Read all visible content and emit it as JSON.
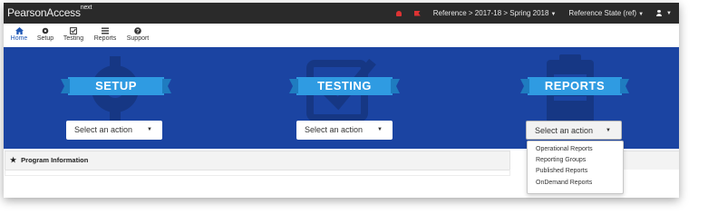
{
  "header": {
    "brand": "PearsonAccess",
    "brand_sup": "next",
    "breadcrumb": "Reference > 2017-18 > Spring 2018",
    "organization": "Reference State (ref)"
  },
  "nav": {
    "items": [
      {
        "label": "Home",
        "icon": "home-icon"
      },
      {
        "label": "Setup",
        "icon": "gear-icon"
      },
      {
        "label": "Testing",
        "icon": "checkbox-icon"
      },
      {
        "label": "Reports",
        "icon": "list-icon"
      },
      {
        "label": "Support",
        "icon": "question-icon"
      }
    ]
  },
  "sections": [
    {
      "title": "SETUP",
      "action_label": "Select an action"
    },
    {
      "title": "TESTING",
      "action_label": "Select an action"
    },
    {
      "title": "REPORTS",
      "action_label": "Select an action"
    }
  ],
  "reports_menu": {
    "items": [
      "Operational Reports",
      "Reporting Groups",
      "Published Reports",
      "OnDemand Reports"
    ]
  },
  "program_panel": {
    "title": "Program Information"
  },
  "colors": {
    "topbar": "#2a2a2a",
    "banner": "#1b44a2",
    "ribbon": "#2f9be2",
    "accent": "#1f57b5",
    "alert": "#dd3333"
  }
}
